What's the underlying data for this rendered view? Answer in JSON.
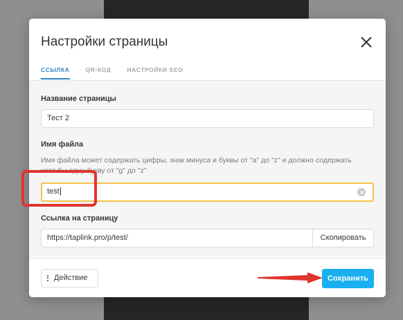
{
  "dialog": {
    "title": "Настройки страницы",
    "tabs": [
      {
        "label": "ССЫЛКА",
        "active": true
      },
      {
        "label": "QR-КОД",
        "active": false
      },
      {
        "label": "НАСТРОЙКИ SEO",
        "active": false
      }
    ]
  },
  "form": {
    "page_name": {
      "label": "Название страницы",
      "value": "Тест 2"
    },
    "file_name": {
      "label": "Имя файла",
      "help": "Имя файла может содержать цифры, знак минуса и буквы от \"a\" до \"z\" и должно содержать хотя бы одну букву от \"g\" до \"z\"",
      "value": "test"
    },
    "page_link": {
      "label": "Ссылка на страницу",
      "value": "https://taplink.pro/p/test/",
      "copy_label": "Скопировать"
    }
  },
  "footer": {
    "action_label": "Действие",
    "save_label": "Сохранить"
  },
  "colors": {
    "accent": "#2c86c9",
    "save": "#1ab0ef",
    "focus": "#f5c24b",
    "annotation": "#e0342f"
  },
  "icons": [
    "close-icon",
    "clear-icon",
    "dots-vertical-icon",
    "arrow-annotation"
  ]
}
